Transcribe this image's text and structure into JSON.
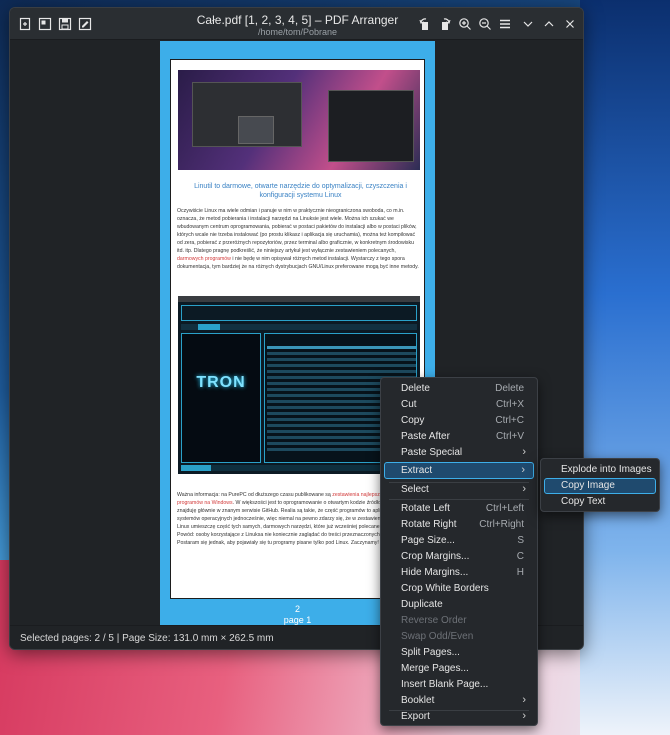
{
  "window": {
    "title": "Całe.pdf [1, 2, 3, 4, 5] – PDF Arranger",
    "subtitle": "/home/tom/Pobrane"
  },
  "toolbar_left_icons": [
    "new-doc-icon",
    "import-icon",
    "save-icon",
    "save-as-icon"
  ],
  "toolbar_right_icons": [
    "rotate-left-icon",
    "rotate-right-icon",
    "zoom-in-icon",
    "zoom-out-icon",
    "hamburger-menu-icon"
  ],
  "window_controls": [
    "minimize-icon",
    "maximize-icon",
    "close-icon"
  ],
  "page": {
    "heading": "Linutil to darmowe, otwarte narzędzie do optymalizacji, czyszczenia i konfiguracji systemu Linux",
    "para1": "Oczywiście Linux ma wiele odmian i panuje w nim w praktycznie nieograniczona swoboda, co m.in. oznacza, że metod pobierania i instalacji narzędzi na Linuksie jest wiele. Można ich szukać we wbudowanym centrum oprogramowania, pobierać w postaci pakietów do instalacji albo w postaci plików, których wcale nie trzeba instalować (po prostu klikasz i aplikacja się uruchamia), można też kompilować od zera, pobierać z przeróżnych repozytoriów, przez terminal albo graficznie, w konkretnym środowisku itd. itp. Dlatego pragnę podkreślić, że niniejszy artykuł jest wyłącznie zestawieniem polecanych,",
    "para1_link": "darmowych programów",
    "para1_end": " i nie będę w nim opisywał różnych metod instalacji. Wystarczy z tego spora dokumentacja, tym bardziej że na różnych dystrybucjach GNU/Linux preferowane mogą być inne metody.",
    "para2_start": "Ważna informacja: na PurePC od dłuższego czasu publikowane są ",
    "para2_link1": "zestawienia najlepszych",
    "para2_link2": "darmowych programów na Windows",
    "para2_end": ". W większości jest to oprogramowanie o otwartym kodzie źródłowym, które znajduję głównie w znanym serwisie GitHub. Realia są takie, że część programów to aplikacje na kilka systemów operacyjnych jednocześnie, więc niemal na pewno zdarzy się, że w zestawieniu programów na Linux umieszczę część tych samych, darmowych narzędzi, które już wcześniej polecane na Windows. Powód: osoby korzystające z Linuksa nie koniecznie zaglądać do treści przeznaczonych dla Windowsa. Postaram się jednak, aby pojawiały się tu programy pisane tylko pod Linux. Zaczynamy!",
    "tron_text": "TRON",
    "page_number": "2",
    "page_label": "page 1"
  },
  "statusbar": {
    "text": "Selected pages: 2 / 5 | Page Size: 131.0 mm × 262.5 mm"
  },
  "context_menu": [
    {
      "label": "Delete",
      "shortcut": "Delete"
    },
    {
      "label": "Cut",
      "shortcut": "Ctrl+X"
    },
    {
      "label": "Copy",
      "shortcut": "Ctrl+C"
    },
    {
      "label": "Paste After",
      "shortcut": "Ctrl+V"
    },
    {
      "label": "Paste Special",
      "shortcut": "",
      "submenu": true
    },
    {
      "label": "Extract",
      "shortcut": "",
      "submenu": true,
      "highlighted": true
    },
    {
      "label": "Select",
      "shortcut": "",
      "submenu": true
    },
    {
      "label": "Rotate Left",
      "shortcut": "Ctrl+Left"
    },
    {
      "label": "Rotate Right",
      "shortcut": "Ctrl+Right"
    },
    {
      "label": "Page Size...",
      "shortcut": "S"
    },
    {
      "label": "Crop Margins...",
      "shortcut": "C"
    },
    {
      "label": "Hide Margins...",
      "shortcut": "H"
    },
    {
      "label": "Crop White Borders",
      "shortcut": ""
    },
    {
      "label": "Duplicate",
      "shortcut": ""
    },
    {
      "label": "Reverse Order",
      "shortcut": "",
      "disabled": true
    },
    {
      "label": "Swap Odd/Even",
      "shortcut": "",
      "disabled": true
    },
    {
      "label": "Split Pages...",
      "shortcut": ""
    },
    {
      "label": "Merge Pages...",
      "shortcut": ""
    },
    {
      "label": "Insert Blank Page...",
      "shortcut": ""
    },
    {
      "label": "Booklet",
      "shortcut": "",
      "submenu": true
    },
    {
      "label": "Export",
      "shortcut": "",
      "submenu": true
    }
  ],
  "extract_submenu": [
    {
      "label": "Explode into Images"
    },
    {
      "label": "Copy Image",
      "highlighted": true
    },
    {
      "label": "Copy Text"
    }
  ],
  "colors": {
    "accent": "#3daee9",
    "highlight_bg": "#1f4a6e",
    "window_bg": "#202326",
    "link_red": "#d23a3a",
    "heading_blue": "#3a82c4"
  }
}
